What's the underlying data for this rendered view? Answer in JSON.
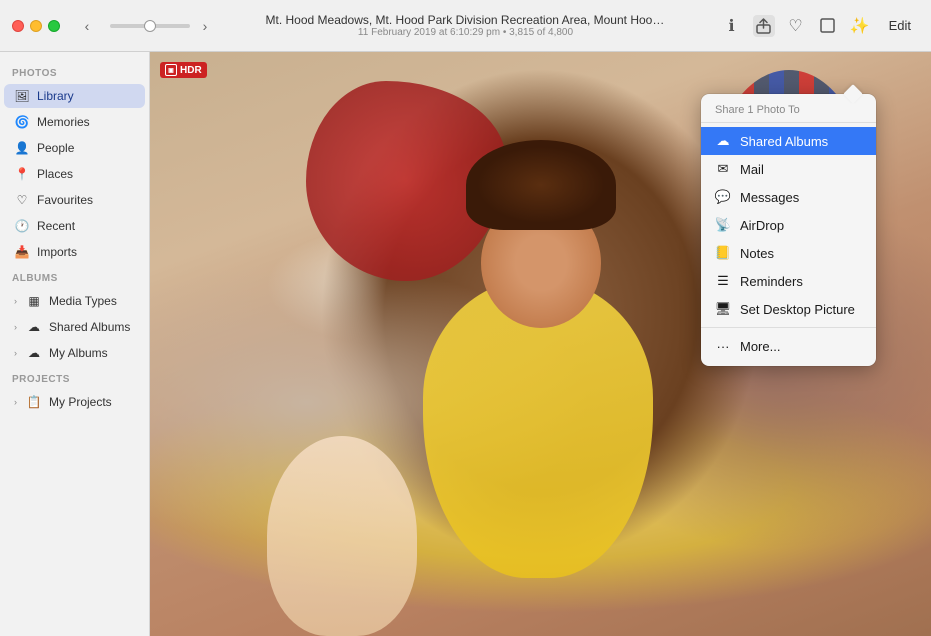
{
  "titlebar": {
    "photo_title": "Mt. Hood Meadows, Mt. Hood Park Division Recreation Area, Mount Hood Parkdale, O...",
    "photo_subtitle": "11 February 2019  at 6:10:29 pm  •  3,815 of 4,800",
    "edit_label": "Edit"
  },
  "sidebar": {
    "photos_label": "Photos",
    "albums_label": "Albums",
    "projects_label": "Projects",
    "items": [
      {
        "id": "library",
        "label": "Library",
        "icon": "🖼",
        "active": true
      },
      {
        "id": "memories",
        "label": "Memories",
        "icon": "🌀"
      },
      {
        "id": "people",
        "label": "People",
        "icon": "👤"
      },
      {
        "id": "places",
        "label": "Places",
        "icon": "📍"
      },
      {
        "id": "favourites",
        "label": "Favourites",
        "icon": "♡"
      },
      {
        "id": "recent",
        "label": "Recent",
        "icon": "🕐"
      },
      {
        "id": "imports",
        "label": "Imports",
        "icon": "📥"
      }
    ],
    "album_items": [
      {
        "id": "media-types",
        "label": "Media Types",
        "icon": "▦",
        "expand": true
      },
      {
        "id": "shared-albums",
        "label": "Shared Albums",
        "icon": "☁",
        "expand": true
      },
      {
        "id": "my-albums",
        "label": "My Albums",
        "icon": "☁",
        "expand": true
      }
    ],
    "project_items": [
      {
        "id": "my-projects",
        "label": "My Projects",
        "icon": "📋",
        "expand": true
      }
    ]
  },
  "hdr_badge": "HDR",
  "share_menu": {
    "title": "Share 1 Photo To",
    "items": [
      {
        "id": "shared-albums",
        "label": "Shared Albums",
        "icon": "☁",
        "selected": true
      },
      {
        "id": "mail",
        "label": "Mail",
        "icon": "✉"
      },
      {
        "id": "messages",
        "label": "Messages",
        "icon": "💬"
      },
      {
        "id": "airdrop",
        "label": "AirDrop",
        "icon": "📡"
      },
      {
        "id": "notes",
        "label": "Notes",
        "icon": "📒"
      },
      {
        "id": "reminders",
        "label": "Reminders",
        "icon": "☰"
      },
      {
        "id": "set-desktop",
        "label": "Set Desktop Picture",
        "icon": "🖥"
      },
      {
        "id": "more",
        "label": "More...",
        "icon": "•••"
      }
    ]
  },
  "icons": {
    "back": "‹",
    "forward": "›",
    "info": "ℹ",
    "heart": "♡",
    "share": "⬆",
    "rotate": "↻",
    "magic": "✨"
  }
}
